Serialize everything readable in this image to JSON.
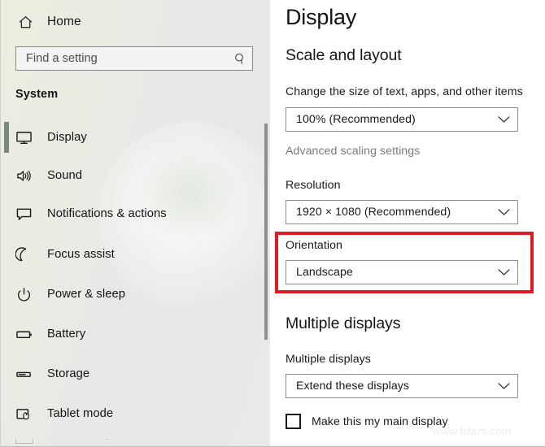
{
  "window": {
    "app": "Settings"
  },
  "sidebar": {
    "home": {
      "label": "Home",
      "icon": "home-icon"
    },
    "search": {
      "value": "",
      "placeholder": "Find a setting",
      "icon": "search-icon"
    },
    "section_heading": "System",
    "selected": "Display",
    "items": [
      {
        "label": "Display",
        "icon": "monitor-icon",
        "selected": true
      },
      {
        "label": "Sound",
        "icon": "speaker-icon",
        "selected": false
      },
      {
        "label": "Notifications & actions",
        "icon": "chat-bubble-icon",
        "selected": false
      },
      {
        "label": "Focus assist",
        "icon": "moon-icon",
        "selected": false
      },
      {
        "label": "Power & sleep",
        "icon": "power-icon",
        "selected": false
      },
      {
        "label": "Battery",
        "icon": "battery-icon",
        "selected": false
      },
      {
        "label": "Storage",
        "icon": "storage-icon",
        "selected": false
      },
      {
        "label": "Tablet mode",
        "icon": "tablet-mode-icon",
        "selected": false
      }
    ]
  },
  "content": {
    "page_title": "Display",
    "scale_section": {
      "heading": "Scale and layout",
      "scale_label": "Change the size of text, apps, and other items",
      "scale_value": "100% (Recommended)",
      "advanced_link": "Advanced scaling settings",
      "resolution_label": "Resolution",
      "resolution_value": "1920 × 1080 (Recommended)",
      "orientation_label": "Orientation",
      "orientation_value": "Landscape"
    },
    "multiple_section": {
      "heading": "Multiple displays",
      "field_label": "Multiple displays",
      "field_value": "Extend these displays",
      "checkbox_label": "Make this my main display",
      "checkbox_checked": false
    }
  },
  "annotation": {
    "highlight_target": "Orientation",
    "highlight_color": "#e01b24"
  },
  "watermark": "www.frfam.com",
  "colors": {
    "accent_selection": "#7b8a78",
    "highlight_red": "#e01b24",
    "sidebar_bg": "#e8e9e4",
    "text_primary": "#151515",
    "text_muted": "#7a7a7a"
  }
}
